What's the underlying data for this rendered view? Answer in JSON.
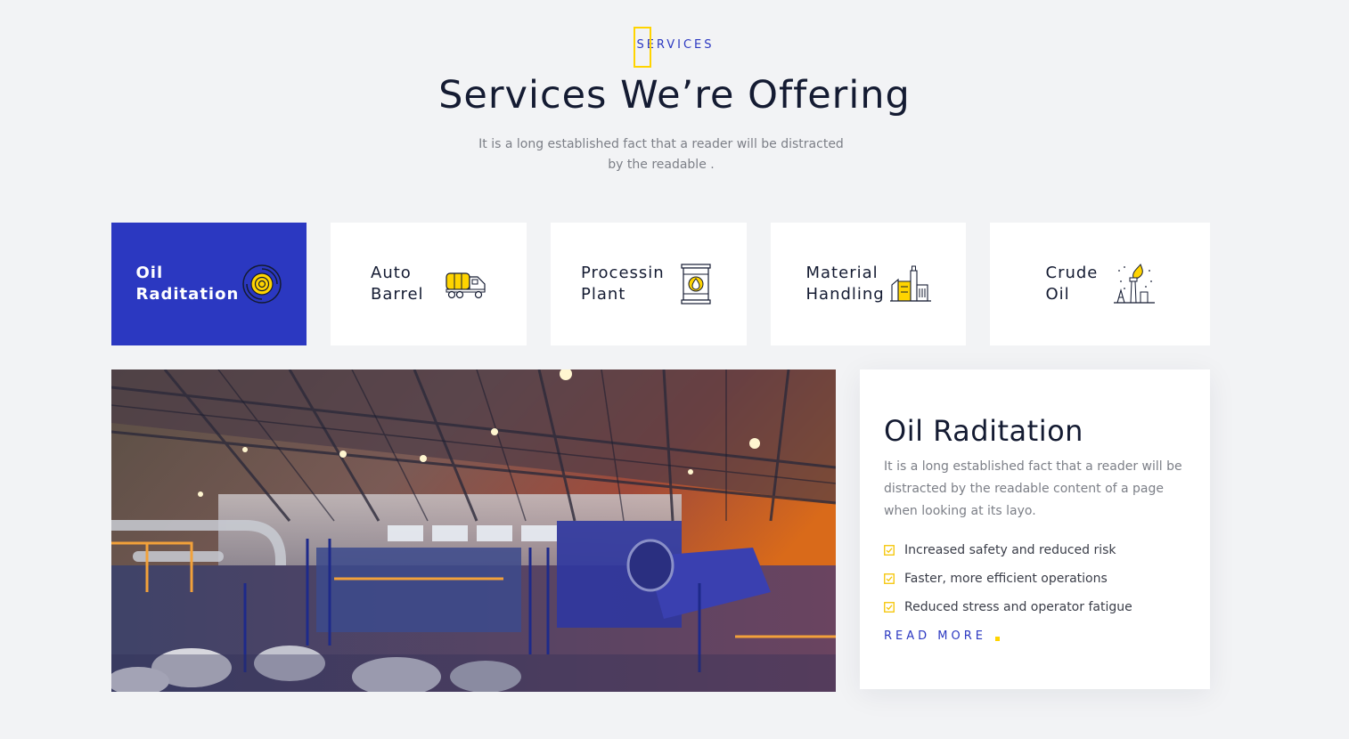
{
  "header": {
    "eyebrow": "SERVICES",
    "title": "Services We’re Offering",
    "subtitle": "It is a long established fact that a reader will be distracted by the readable ."
  },
  "tabs": [
    {
      "label": "Oil Raditation",
      "icon": "radiation-target-icon",
      "active": true
    },
    {
      "label": "Auto Barrel",
      "icon": "tanker-truck-icon",
      "active": false
    },
    {
      "label": "Processin Plant",
      "icon": "oil-barrel-icon",
      "active": false
    },
    {
      "label": "Material Handling",
      "icon": "factory-icon",
      "active": false
    },
    {
      "label": "Crude Oil",
      "icon": "oil-rig-flame-icon",
      "active": false
    }
  ],
  "detail": {
    "title": "Oil Raditation",
    "text": "It is a long established fact that a reader will be distracted by the readable content of a page when looking at its layo.",
    "features": [
      "Increased safety and reduced risk",
      "Faster, more efficient operations",
      "Reduced stress and operator fatigue"
    ],
    "read_more": "READ MORE"
  },
  "colors": {
    "accent_blue": "#2b38c1",
    "accent_yellow": "#ffd400",
    "heading": "#141b32",
    "background": "#f2f3f5"
  }
}
